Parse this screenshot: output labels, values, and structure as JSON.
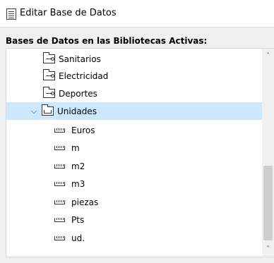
{
  "window": {
    "title": "Editar Base de Datos"
  },
  "section": {
    "label": "Bases de Datos en las Bibliotecas Activas:"
  },
  "tree": {
    "items": [
      {
        "label": "Sanitarios",
        "icon": "key-folder-icon"
      },
      {
        "label": "Electricidad",
        "icon": "key-folder-icon"
      },
      {
        "label": "Deportes",
        "icon": "key-folder-icon"
      },
      {
        "label": "Unidades",
        "icon": "ruler-folder-icon",
        "expanded": true,
        "selected": true
      },
      {
        "label": "Euros",
        "icon": "ruler-icon"
      },
      {
        "label": "m",
        "icon": "ruler-icon"
      },
      {
        "label": "m2",
        "icon": "ruler-icon"
      },
      {
        "label": "m3",
        "icon": "ruler-icon"
      },
      {
        "label": "piezas",
        "icon": "ruler-icon"
      },
      {
        "label": "Pts",
        "icon": "ruler-icon"
      },
      {
        "label": "ud.",
        "icon": "ruler-icon"
      }
    ]
  },
  "colors": {
    "selection": "#cce8ff",
    "scroll_thumb": "#cdcdcd"
  }
}
